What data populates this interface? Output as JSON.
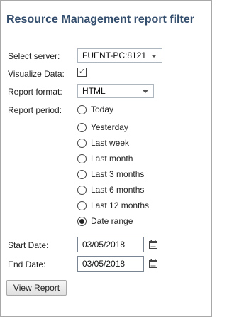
{
  "title": "Resource Management report filter",
  "fields": {
    "server_label": "Select server:",
    "server_value": "FUENT-PC:8121",
    "visualize_label": "Visualize Data:",
    "visualize_checked": true,
    "format_label": "Report format:",
    "format_value": "HTML",
    "period_label": "Report period:",
    "period_options": [
      {
        "label": "Today",
        "selected": false
      },
      {
        "label": "Yesterday",
        "selected": false
      },
      {
        "label": "Last week",
        "selected": false
      },
      {
        "label": "Last month",
        "selected": false
      },
      {
        "label": "Last 3 months",
        "selected": false
      },
      {
        "label": "Last 6 months",
        "selected": false
      },
      {
        "label": "Last 12 months",
        "selected": false
      },
      {
        "label": "Date range",
        "selected": true
      }
    ],
    "start_label": "Start Date:",
    "start_value": "03/05/2018",
    "end_label": "End Date:",
    "end_value": "03/05/2018"
  },
  "button": {
    "view_report": "View Report"
  },
  "icons": {
    "checkbox_mark": "✓",
    "calendar": "calendar-icon"
  }
}
